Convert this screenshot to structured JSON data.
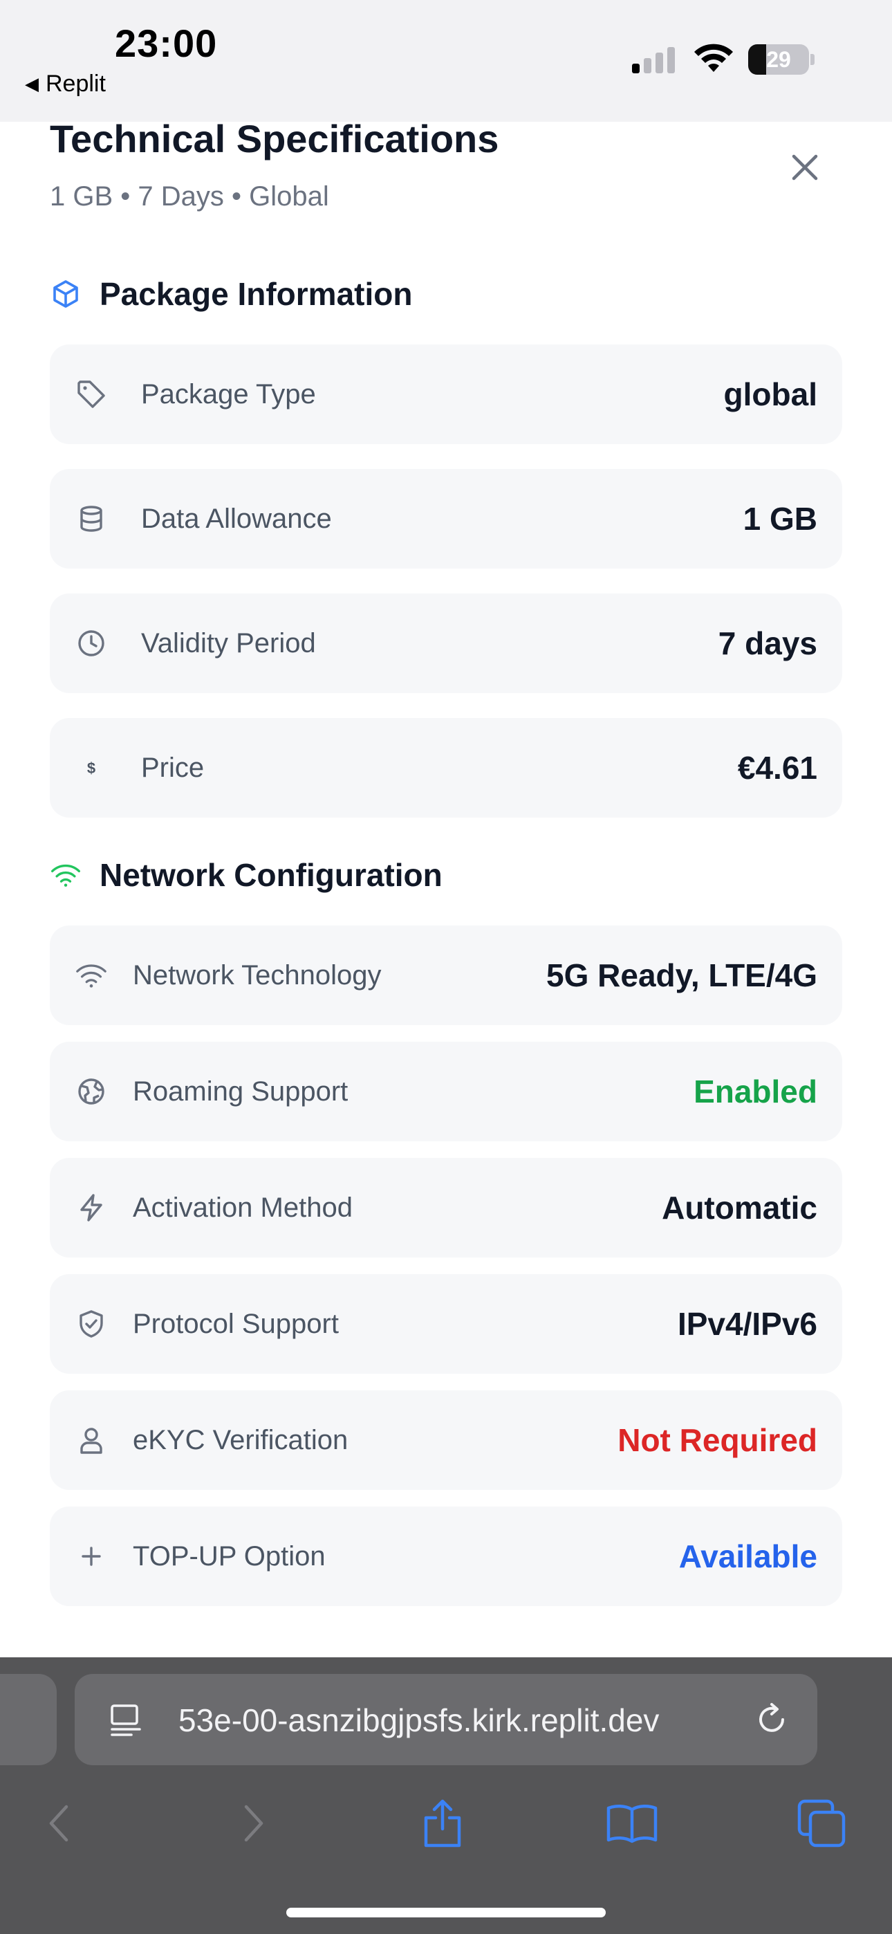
{
  "status_bar": {
    "time": "23:00",
    "back_app": "Replit",
    "battery": "29",
    "battery_level": 0.29
  },
  "header": {
    "title": "Technical Specifications",
    "subtitle": "1 GB • 7 Days • Global"
  },
  "package_section": {
    "title": "Package Information",
    "rows": [
      {
        "label": "Package Type",
        "value": "global",
        "icon": "tag-icon"
      },
      {
        "label": "Data Allowance",
        "value": "1 GB",
        "icon": "database-icon"
      },
      {
        "label": "Validity Period",
        "value": "7 days",
        "icon": "clock-icon"
      },
      {
        "label": "Price",
        "value": "€4.61",
        "icon": "dollar-icon"
      }
    ]
  },
  "network_section": {
    "title": "Network Configuration",
    "rows": [
      {
        "label": "Network Technology",
        "value": "5G Ready, LTE/4G",
        "icon": "wifi-icon"
      },
      {
        "label": "Roaming Support",
        "value": "Enabled",
        "icon": "globe-icon"
      },
      {
        "label": "Activation Method",
        "value": "Automatic",
        "icon": "bolt-icon"
      },
      {
        "label": "Protocol Support",
        "value": "IPv4/IPv6",
        "icon": "shield-check-icon"
      },
      {
        "label": "eKYC Verification",
        "value": "Not Required",
        "icon": "user-icon"
      },
      {
        "label": "TOP-UP Option",
        "value": "Available",
        "icon": "plus-icon"
      }
    ]
  },
  "browser": {
    "url": "53e-00-asnzibgjpsfs.kirk.replit.dev"
  },
  "colors": {
    "accent_blue": "#2563eb",
    "status_green": "#16a34a",
    "status_red": "#dc2626",
    "row_bg": "#f6f7f9"
  }
}
